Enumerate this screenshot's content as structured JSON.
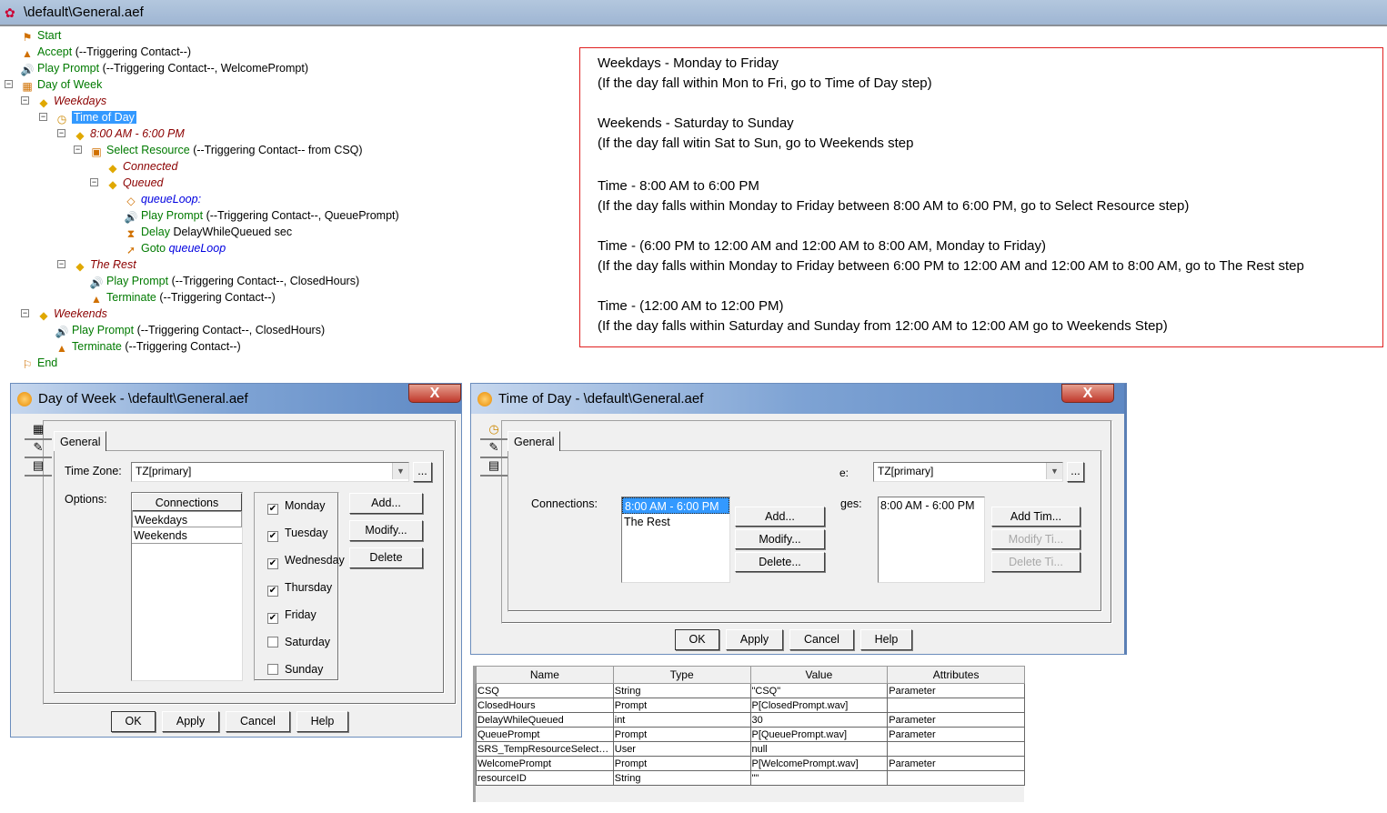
{
  "window": {
    "title": "\\default\\General.aef"
  },
  "tree": [
    {
      "level": 0,
      "icon": "start-flag-icon",
      "glyph": "⚑",
      "name": "Start",
      "args": "",
      "style": "step"
    },
    {
      "level": 0,
      "icon": "accept-icon",
      "glyph": "▲",
      "name": "Accept",
      "args": " (--Triggering Contact--)",
      "style": "step"
    },
    {
      "level": 0,
      "icon": "speaker-icon",
      "glyph": "🔊",
      "name": "Play Prompt",
      "args": " (--Triggering Contact--, WelcomePrompt)",
      "style": "step"
    },
    {
      "level": 0,
      "icon": "calendar-icon",
      "glyph": "▦",
      "name": "Day of Week",
      "args": "",
      "style": "step",
      "toggle": true
    },
    {
      "level": 1,
      "icon": "branch-icon",
      "glyph": "◆",
      "name": "Weekdays",
      "args": "",
      "style": "branch",
      "toggle": true
    },
    {
      "level": 2,
      "icon": "clock-icon",
      "glyph": "◷",
      "name": "Time of Day",
      "args": "",
      "style": "step",
      "toggle": true,
      "selected": true
    },
    {
      "level": 3,
      "icon": "branch-icon",
      "glyph": "◆",
      "name": "8:00 AM - 6:00 PM",
      "args": "",
      "style": "branch",
      "toggle": true
    },
    {
      "level": 4,
      "icon": "select-resource-icon",
      "glyph": "▣",
      "name": "Select Resource",
      "args": " (--Triggering Contact-- from CSQ)",
      "style": "step",
      "toggle": true
    },
    {
      "level": 5,
      "icon": "branch-icon",
      "glyph": "◆",
      "name": "Connected",
      "args": "",
      "style": "branch"
    },
    {
      "level": 5,
      "icon": "branch-icon",
      "glyph": "◆",
      "name": "Queued",
      "args": "",
      "style": "branch",
      "toggle": true
    },
    {
      "level": 6,
      "icon": "label-tag-icon",
      "glyph": "◇",
      "name": "queueLoop:",
      "args": "",
      "style": "label"
    },
    {
      "level": 6,
      "icon": "speaker-icon",
      "glyph": "🔊",
      "name": "Play Prompt",
      "args": " (--Triggering Contact--, QueuePrompt)",
      "style": "step"
    },
    {
      "level": 6,
      "icon": "hourglass-icon",
      "glyph": "⧗",
      "name": "Delay",
      "args": " DelayWhileQueued sec",
      "style": "step"
    },
    {
      "level": 6,
      "icon": "goto-icon",
      "glyph": "➚",
      "name": "Goto",
      "args": "",
      "label": " queueLoop",
      "style": "step"
    },
    {
      "level": 3,
      "icon": "branch-icon",
      "glyph": "◆",
      "name": "The Rest",
      "args": "",
      "style": "branch",
      "toggle": true
    },
    {
      "level": 4,
      "icon": "speaker-icon",
      "glyph": "🔊",
      "name": "Play Prompt",
      "args": " (--Triggering Contact--, ClosedHours)",
      "style": "step"
    },
    {
      "level": 4,
      "icon": "terminate-icon",
      "glyph": "▲",
      "name": "Terminate",
      "args": " (--Triggering Contact--)",
      "style": "step"
    },
    {
      "level": 1,
      "icon": "branch-icon",
      "glyph": "◆",
      "name": "Weekends",
      "args": "",
      "style": "branch",
      "toggle": true
    },
    {
      "level": 2,
      "icon": "speaker-icon",
      "glyph": "🔊",
      "name": "Play Prompt",
      "args": " (--Triggering Contact--, ClosedHours)",
      "style": "step"
    },
    {
      "level": 2,
      "icon": "terminate-icon",
      "glyph": "▲",
      "name": "Terminate",
      "args": " (--Triggering Contact--)",
      "style": "step"
    },
    {
      "level": 0,
      "icon": "end-flag-icon",
      "glyph": "⚐",
      "name": "End",
      "args": "",
      "style": "step"
    }
  ],
  "notes": [
    "Weekdays - Monday to Friday",
    "(If the day fall within Mon to Fri, go to Time of Day step)",
    "Weekends - Saturday to Sunday",
    "(If the day fall witin Sat to Sun, go to Weekends step",
    "Time - 8:00 AM to 6:00 PM",
    "(If the day falls within Monday to Friday between 8:00 AM to 6:00 PM, go to Select Resource step)",
    "Time - (6:00 PM to 12:00 AM and 12:00 AM to 8:00 AM, Monday to Friday)",
    "(If the day falls within Monday to Friday between 6:00 PM to 12:00 AM and 12:00 AM to 8:00 AM, go to The Rest step",
    "Time - (12:00 AM to 12:00 PM)",
    "(If the day falls within Saturday and Sunday from 12:00 AM to 12:00 AM go to Weekends Step)"
  ],
  "dow": {
    "title": "Day of Week - \\default\\General.aef",
    "close": "X",
    "tab": "General",
    "tz_label": "Time Zone:",
    "tz_value": "TZ[primary]",
    "browse": "...",
    "options_label": "Options:",
    "conn_header": "Connections",
    "connections": [
      "Weekdays",
      "Weekends"
    ],
    "days": [
      {
        "label": "Monday",
        "checked": true
      },
      {
        "label": "Tuesday",
        "checked": true
      },
      {
        "label": "Wednesday",
        "checked": true
      },
      {
        "label": "Thursday",
        "checked": true
      },
      {
        "label": "Friday",
        "checked": true
      },
      {
        "label": "Saturday",
        "checked": false
      },
      {
        "label": "Sunday",
        "checked": false
      }
    ],
    "add": "Add...",
    "modify": "Modify...",
    "delete": "Delete",
    "ok": "OK",
    "apply": "Apply",
    "cancel": "Cancel",
    "help": "Help"
  },
  "tod": {
    "title": "Time of Day - \\default\\General.aef",
    "close": "X",
    "tab": "General",
    "tz_label_partial": "e:",
    "tz_value": "TZ[primary]",
    "browse": "...",
    "conn_label": "Connections:",
    "connections": [
      "8:00 AM - 6:00 PM",
      "The Rest"
    ],
    "add": "Add...",
    "modify": "Modify...",
    "delete": "Delete...",
    "ranges_label_partial": "ges:",
    "ranges": [
      "8:00 AM - 6:00 PM"
    ],
    "add_time": "Add Tim...",
    "modify_time": "Modify Ti...",
    "delete_time": "Delete Ti...",
    "ok": "OK",
    "apply": "Apply",
    "cancel": "Cancel",
    "help": "Help"
  },
  "variables": {
    "columns": [
      "Name",
      "Type",
      "Value",
      "Attributes"
    ],
    "rows": [
      [
        "CSQ",
        "String",
        "\"CSQ\"",
        "Parameter"
      ],
      [
        "ClosedHours",
        "Prompt",
        "P[ClosedPrompt.wav]",
        ""
      ],
      [
        "DelayWhileQueued",
        "int",
        "30",
        "Parameter"
      ],
      [
        "QueuePrompt",
        "Prompt",
        "P[QueuePrompt.wav]",
        "Parameter"
      ],
      [
        "SRS_TempResourceSelecte...",
        "User",
        "null",
        ""
      ],
      [
        "WelcomePrompt",
        "Prompt",
        "P[WelcomePrompt.wav]",
        "Parameter"
      ],
      [
        "resourceID",
        "String",
        "\"\"",
        ""
      ]
    ]
  }
}
